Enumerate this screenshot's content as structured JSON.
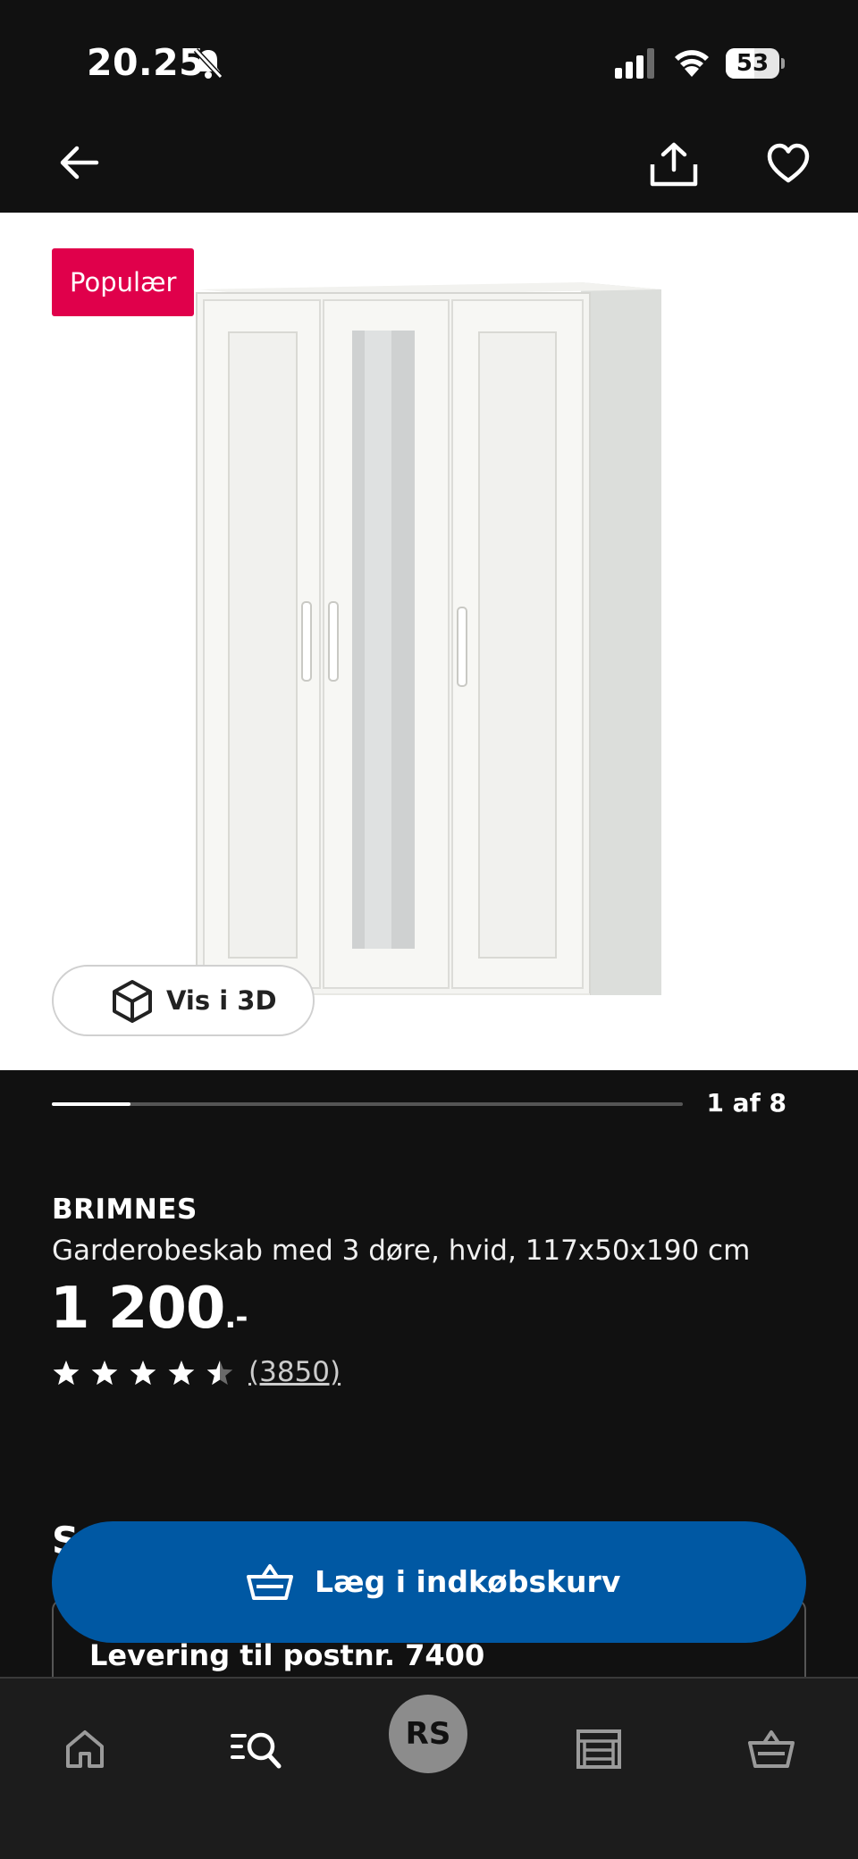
{
  "status_bar": {
    "time": "20.25",
    "battery_label": "53",
    "battery_level": 0.53
  },
  "nav": {
    "icons": [
      "arrow-left-icon",
      "share-icon",
      "heart-icon"
    ]
  },
  "gallery": {
    "badge": "Populær",
    "view_3d_label": "Vis i 3D",
    "counter": "1 af 8",
    "current_index": 1,
    "total_images": 8
  },
  "product": {
    "name": "BRIMNES",
    "description": "Garderobeskab med 3 døre, hvid, 117x50x190 cm",
    "price": "1 200",
    "price_suffix": ".-",
    "rating": 4.5,
    "max_rating": 5,
    "review_count": "(3850)"
  },
  "section": {
    "heading_peek": "S",
    "delivery_label": "Levering til postnr. 7400"
  },
  "cart_button": {
    "label": "Læg i indkøbskurv",
    "color": "#0058a3"
  },
  "bottom_nav": {
    "avatar_initials": "RS",
    "items": [
      "home-icon",
      "search-icon",
      "avatar",
      "store-icon",
      "cart-icon"
    ]
  },
  "colors": {
    "badge": "#e0004b",
    "background": "#111111",
    "accent": "#0058a3"
  }
}
